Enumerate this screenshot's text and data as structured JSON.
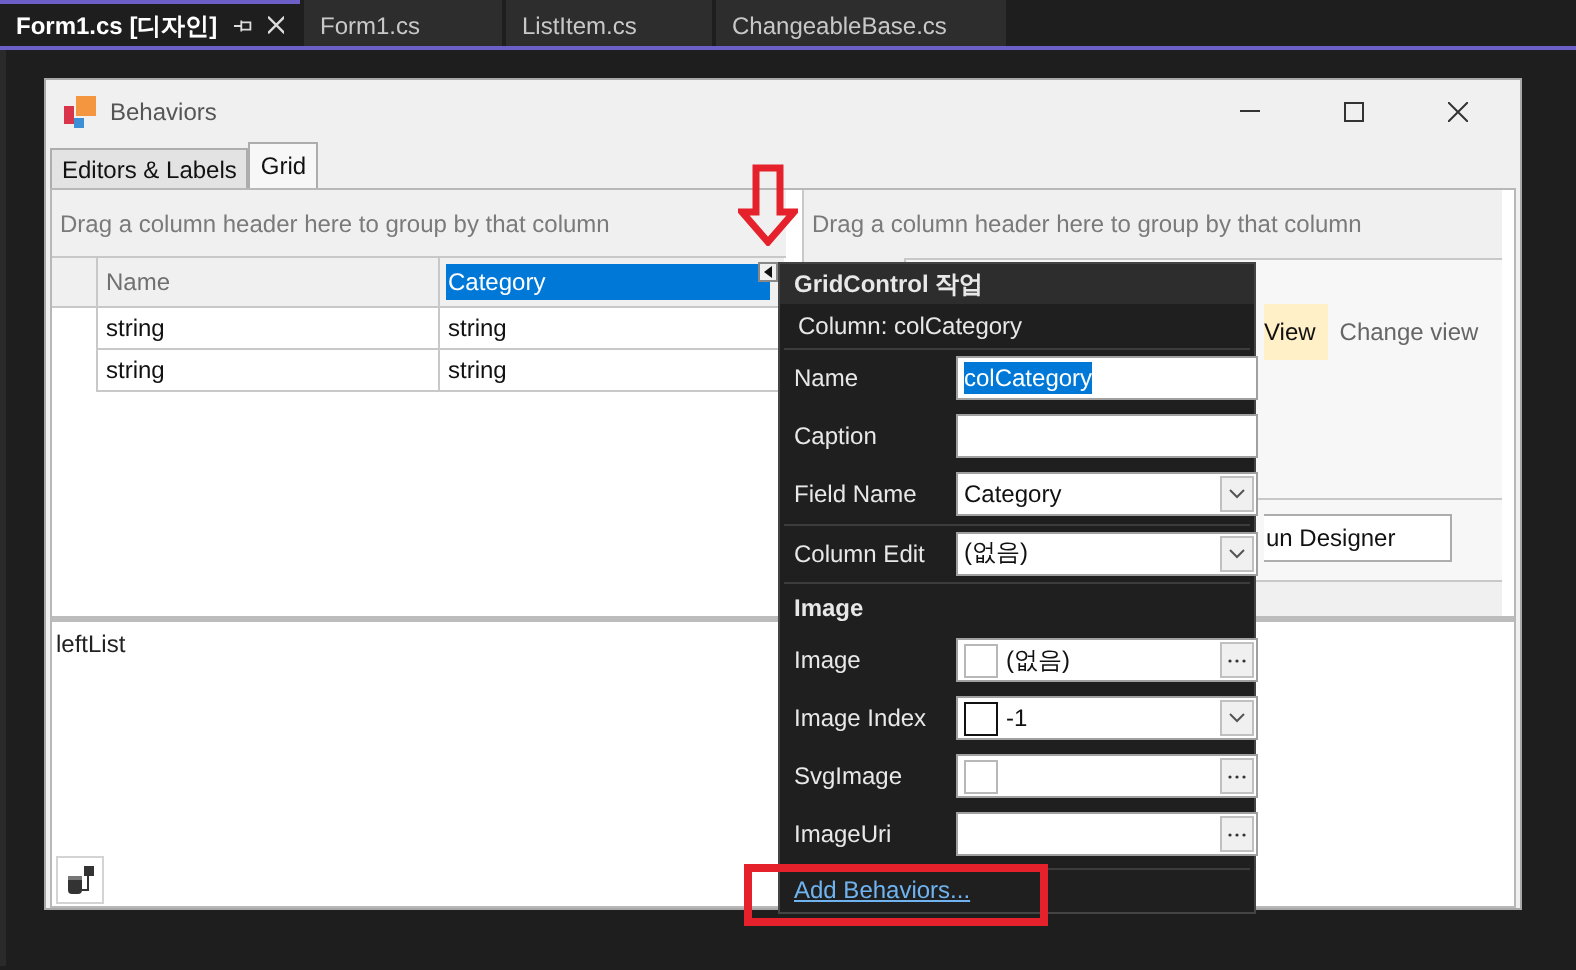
{
  "document_tabs": [
    {
      "label": "Form1.cs [디자인]",
      "selected": true
    },
    {
      "label": "Form1.cs",
      "selected": false
    },
    {
      "label": "ListItem.cs",
      "selected": false
    },
    {
      "label": "ChangeableBase.cs",
      "selected": false
    }
  ],
  "form": {
    "title": "Behaviors",
    "tabs": [
      {
        "label": "Editors & Labels",
        "selected": false
      },
      {
        "label": "Grid",
        "selected": true
      }
    ],
    "left_grid": {
      "group_panel_text": "Drag a column header here to group by that column",
      "columns": [
        {
          "caption": "Name",
          "selected": false
        },
        {
          "caption": "Category",
          "selected": true
        }
      ],
      "rows": [
        [
          "string",
          "string"
        ],
        [
          "string",
          "string"
        ]
      ]
    },
    "right_grid": {
      "group_panel_text": "Drag a column header here to group by that column",
      "view_label": "View",
      "change_view_link": "Change view",
      "run_designer_button": "un Designer"
    },
    "bottom_label": "leftList"
  },
  "smart_tag": {
    "title": "GridControl 작업",
    "subtitle": "Column: colCategory",
    "rows": [
      {
        "kind": "text",
        "label": "Name",
        "value": "colCategory",
        "selected": true,
        "divider_before": false
      },
      {
        "kind": "text",
        "label": "Caption",
        "divider_before": false
      },
      {
        "kind": "combo",
        "label": "Field Name",
        "value": "Category",
        "divider_before": false
      },
      {
        "kind": "combo",
        "label": "Column Edit",
        "value": "(없음)",
        "divider_before": true
      },
      {
        "kind": "section",
        "label": "Image",
        "divider_before": true
      },
      {
        "kind": "picker",
        "label": "Image",
        "value": "(없음)",
        "divider_before": false
      },
      {
        "kind": "combo_swatch",
        "label": "Image Index",
        "value": "-1",
        "divider_before": false
      },
      {
        "kind": "picker",
        "label": "SvgImage",
        "divider_before": false
      },
      {
        "kind": "browse",
        "label": "ImageUri",
        "divider_before": false
      }
    ],
    "link": "Add Behaviors..."
  }
}
